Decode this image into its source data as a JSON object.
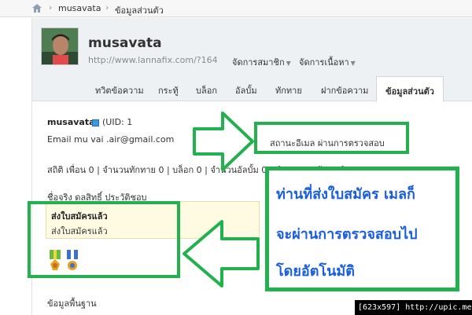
{
  "breadcrumb": {
    "items": [
      "musavata",
      "ข้อมูลส่วนตัว"
    ]
  },
  "profile": {
    "username": "musavata",
    "url": "http://www.lannafix.com/?164",
    "menus": [
      "จัดการสมาชิก",
      "จัดการเนื้อหา"
    ]
  },
  "tabs": [
    "ทวิตข้อความ",
    "กระทู้",
    "บล็อก",
    "อัลบั้ม",
    "ทักทาย",
    "ฝากข้อความ",
    "ข้อมูลส่วนตัว"
  ],
  "active_tab": "ข้อมูลส่วนตัว",
  "info": {
    "name": "musavata",
    "uid": "(UID: 1",
    "email": "Email   mu   vai  .air@gmail.com",
    "stats": "สถิติ  เพื่อน 0  |  จำนวนทักทาย 0  |  บล็อก 0  |  จำนวนอัลบั้ม 0  |  จำนวนกระทู้ 1  |  จำนวนตอบ 0",
    "email_status": "สถานะอีเมล    ผ่านการตรวจสอบ",
    "realname": "ชื่อจริง   ดลสิทธิ์ ประวัติชอบ"
  },
  "tooltip": {
    "title": "ส่งใบสมัครแล้ว",
    "subtitle": "ส่งใบสมัครแล้ว"
  },
  "message": {
    "line1": "ท่านที่ส่งใบสมัคร เมลก็",
    "line2": "จะผ่านการตรวจสอบไป",
    "line3": "โดยอัตโนมัติ"
  },
  "bottom_text": "ข้อมูลพื้นฐาน",
  "footer_tag": "[623x597] http://upic.me/",
  "colors": {
    "highlight_green": "#22b14c",
    "message_blue": "#1a5ee0",
    "uid_badge_blue": "#3a9be0"
  },
  "icons": [
    "home-icon",
    "verified-badge-icon",
    "medal-icon"
  ]
}
